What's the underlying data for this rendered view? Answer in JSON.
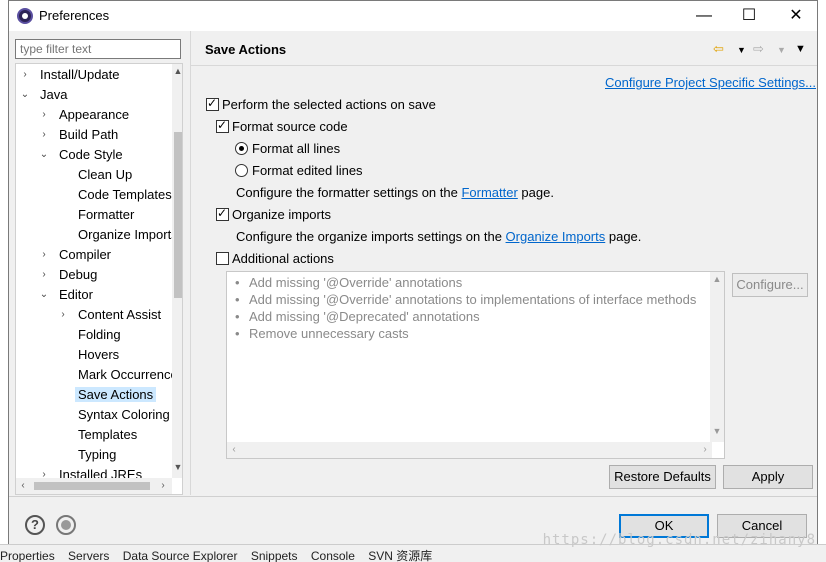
{
  "window": {
    "title": "Preferences",
    "minimize": "—",
    "maximize": "☐",
    "close": "✕"
  },
  "filter": {
    "placeholder": "type filter text"
  },
  "tree": {
    "items": [
      {
        "label": "Install/Update",
        "arrow": "›"
      },
      {
        "label": "Java",
        "arrow": "⌄"
      },
      {
        "label": "Appearance",
        "arrow": "›"
      },
      {
        "label": "Build Path",
        "arrow": "›"
      },
      {
        "label": "Code Style",
        "arrow": "⌄"
      },
      {
        "label": "Clean Up"
      },
      {
        "label": "Code Templates"
      },
      {
        "label": "Formatter"
      },
      {
        "label": "Organize Imports"
      },
      {
        "label": "Compiler",
        "arrow": "›"
      },
      {
        "label": "Debug",
        "arrow": "›"
      },
      {
        "label": "Editor",
        "arrow": "⌄"
      },
      {
        "label": "Content Assist",
        "arrow": "›"
      },
      {
        "label": "Folding"
      },
      {
        "label": "Hovers"
      },
      {
        "label": "Mark Occurrences"
      },
      {
        "label": "Save Actions",
        "selected": true
      },
      {
        "label": "Syntax Coloring"
      },
      {
        "label": "Templates"
      },
      {
        "label": "Typing"
      },
      {
        "label": "Installed JREs",
        "arrow": "›"
      }
    ]
  },
  "page": {
    "title": "Save Actions",
    "project_link": "Configure Project Specific Settings...",
    "perform_actions": "Perform the selected actions on save",
    "format_source": "Format source code",
    "format_all": "Format all lines",
    "format_edited": "Format edited lines",
    "formatter_prefix": "Configure the formatter settings on the ",
    "formatter_link": "Formatter",
    "formatter_suffix": " page.",
    "organize_imports": "Organize imports",
    "organize_prefix": "Configure the organize imports settings on the ",
    "organize_link": "Organize Imports",
    "organize_suffix": " page.",
    "additional_actions": "Additional actions",
    "actions": [
      "Add missing '@Override' annotations",
      "Add missing '@Override' annotations to implementations of interface methods",
      "Add missing '@Deprecated' annotations",
      "Remove unnecessary casts"
    ],
    "configure_button": "Configure...",
    "restore_button": "Restore Defaults",
    "apply_button": "Apply"
  },
  "footer": {
    "ok_button": "OK",
    "cancel_button": "Cancel"
  },
  "background": {
    "bottom_tabs": [
      "Properties",
      "Servers",
      "Data Source Explorer",
      "Snippets",
      "Console",
      "SVN 资源库"
    ],
    "watermark": "https://blog.csdn.net/zihany8"
  }
}
